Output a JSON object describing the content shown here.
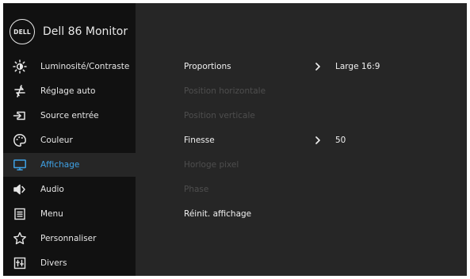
{
  "brand": {
    "logo_text": "DELL",
    "model": "Dell 86 Monitor"
  },
  "sidebar": {
    "items": [
      {
        "label": "Luminosité/Contraste",
        "icon": "brightness-icon",
        "active": false
      },
      {
        "label": "Réglage auto",
        "icon": "auto-adjust-icon",
        "active": false
      },
      {
        "label": "Source entrée",
        "icon": "input-source-icon",
        "active": false
      },
      {
        "label": "Couleur",
        "icon": "color-palette-icon",
        "active": false
      },
      {
        "label": "Affichage",
        "icon": "display-icon",
        "active": true
      },
      {
        "label": "Audio",
        "icon": "speaker-icon",
        "active": false
      },
      {
        "label": "Menu",
        "icon": "menu-icon",
        "active": false
      },
      {
        "label": "Personnaliser",
        "icon": "star-icon",
        "active": false
      },
      {
        "label": "Divers",
        "icon": "others-icon",
        "active": false
      }
    ]
  },
  "display_menu": {
    "rows": [
      {
        "label": "Proportions",
        "value": "Large 16:9",
        "enabled": true,
        "has_submenu": true
      },
      {
        "label": "Position horizontale",
        "value": "",
        "enabled": false,
        "has_submenu": false
      },
      {
        "label": "Position verticale",
        "value": "",
        "enabled": false,
        "has_submenu": false
      },
      {
        "label": "Finesse",
        "value": "50",
        "enabled": true,
        "has_submenu": true
      },
      {
        "label": "Horloge pixel",
        "value": "",
        "enabled": false,
        "has_submenu": false
      },
      {
        "label": "Phase",
        "value": "",
        "enabled": false,
        "has_submenu": false
      },
      {
        "label": "Réinit. affichage",
        "value": "",
        "enabled": true,
        "has_submenu": false
      }
    ]
  },
  "colors": {
    "accent": "#3fa2e6",
    "panel": "#262626",
    "sidebar": "#111111",
    "disabled_text": "#4e4e4e"
  }
}
